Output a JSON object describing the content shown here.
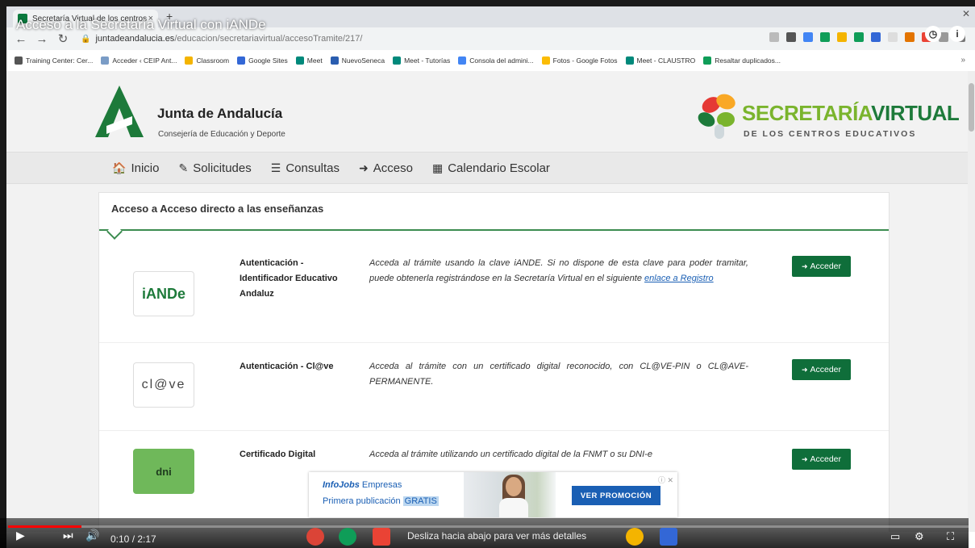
{
  "video": {
    "title": "Acceso a la Secretaría Virtual con iANDe",
    "time": "0:10 / 2:17",
    "swipe_hint": "Desliza hacia abajo para ver más detalles",
    "progress": 0.076
  },
  "browser": {
    "tab_title": "Secretaría Virtual de los centros",
    "url_host": "juntadeandalucia.es",
    "url_path": "/educacion/secretariavirtual/accesoTramite/217/",
    "bookmarks": [
      {
        "label": "Training Center: Cer...",
        "color": "#555555"
      },
      {
        "label": "Acceder ‹ CEIP Ant...",
        "color": "#7a9cc6"
      },
      {
        "label": "Classroom",
        "color": "#f4b400"
      },
      {
        "label": "Google Sites",
        "color": "#3367d6"
      },
      {
        "label": "Meet",
        "color": "#00897b"
      },
      {
        "label": "NuevoSeneca",
        "color": "#2a5db0"
      },
      {
        "label": "Meet - Tutorías",
        "color": "#00897b"
      },
      {
        "label": "Consola del admini...",
        "color": "#4285f4"
      },
      {
        "label": "Fotos - Google Fotos",
        "color": "#fbbc05"
      },
      {
        "label": "Meet - CLAUSTRO",
        "color": "#00897b"
      },
      {
        "label": "Resaltar duplicados...",
        "color": "#0f9d58"
      }
    ],
    "bookmarks_more": "»"
  },
  "header": {
    "brand_title": "Junta de Andalucía",
    "brand_subtitle": "Consejería de Educación y Deporte",
    "sv_title_part1": "SECRETARÍA",
    "sv_title_part2": "VIRTUAL",
    "sv_subtitle": "DE LOS CENTROS EDUCATIVOS"
  },
  "nav": {
    "items": [
      {
        "label": "Inicio",
        "icon": "home-icon",
        "glyph": "🏠"
      },
      {
        "label": "Solicitudes",
        "icon": "pencil-icon",
        "glyph": "✎"
      },
      {
        "label": "Consultas",
        "icon": "list-icon",
        "glyph": "☰"
      },
      {
        "label": "Acceso",
        "icon": "sign-in-icon",
        "glyph": "➜"
      },
      {
        "label": "Calendario Escolar",
        "icon": "calendar-icon",
        "glyph": "▦"
      }
    ]
  },
  "card": {
    "title": "Acceso a Acceso directo a las enseñanzas",
    "button_label": "Acceder",
    "rows": [
      {
        "logo": "iANDe",
        "name": "Autenticación - Identificador Educativo Andaluz",
        "desc": "Acceda al trámite usando la clave iANDE. Si no dispone de esta clave para poder tramitar, puede obtenerla registrándose en la Secretaría Virtual en el siguiente",
        "link": "enlace a Registro"
      },
      {
        "logo": "cl@ve",
        "name": "Autenticación - Cl@ve",
        "desc": "Acceda al trámite con un certificado digital reconocido, con CL@VE-PIN o CL@AVE-PERMANENTE."
      },
      {
        "logo": "dni",
        "name": "Certificado Digital",
        "desc": "Acceda al trámite utilizando un certificado digital de la FNMT o su DNI-e"
      }
    ]
  },
  "ad": {
    "brand": "InfoJobs",
    "brand_suffix": "Empresas",
    "line_prefix": "Primera publicación",
    "line_highlight": "GRATIS",
    "cta": "VER PROMOCIÓN"
  }
}
